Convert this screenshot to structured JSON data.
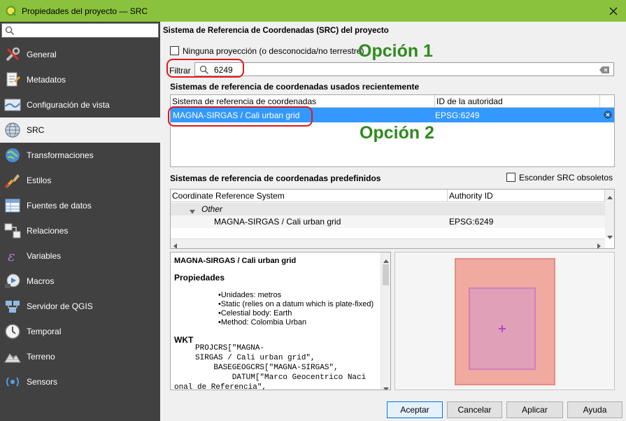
{
  "window": {
    "title": "Propiedades del proyecto — SRC"
  },
  "sidebar": {
    "items": [
      {
        "label": "General",
        "icon": "wrench-screwdriver-icon"
      },
      {
        "label": "Metadatos",
        "icon": "metadata-document-icon"
      },
      {
        "label": "Configuración de vista",
        "icon": "map-view-icon"
      },
      {
        "label": "SRC",
        "icon": "globe-icon",
        "selected": true
      },
      {
        "label": "Transformaciones",
        "icon": "globe-transform-icon"
      },
      {
        "label": "Estilos",
        "icon": "paint-brush-icon"
      },
      {
        "label": "Fuentes de datos",
        "icon": "table-icon"
      },
      {
        "label": "Relaciones",
        "icon": "relations-icon"
      },
      {
        "label": "Variables",
        "icon": "variable-icon"
      },
      {
        "label": "Macros",
        "icon": "macro-icon"
      },
      {
        "label": "Servidor de QGIS",
        "icon": "server-icon"
      },
      {
        "label": "Temporal",
        "icon": "clock-icon"
      },
      {
        "label": "Terreno",
        "icon": "terrain-icon"
      },
      {
        "label": "Sensors",
        "icon": "sensor-icon"
      }
    ]
  },
  "panel": {
    "title": "Sistema de Referencia de Coordenadas (SRC) del proyecto",
    "no_projection_label": "Ninguna proyección (o desconocida/no terrestre)",
    "filter_label": "Filtrar",
    "filter_value": "6249",
    "recent": {
      "title": "Sistemas de referencia de coordenadas usados recientemente",
      "headers": [
        "Sistema de referencia de coordenadas",
        "ID de la autoridad"
      ],
      "row": {
        "name": "MAGNA-SIRGAS / Cali urban grid",
        "id": "EPSG:6249"
      }
    },
    "predefined": {
      "title": "Sistemas de referencia de coordenadas predefinidos",
      "hide_label": "Esconder SRC obsoletos",
      "headers": [
        "Coordinate Reference System",
        "Authority ID"
      ],
      "group": "Other",
      "row": {
        "name": "MAGNA-SIRGAS / Cali urban grid",
        "id": "EPSG:6249"
      }
    },
    "details": {
      "name": "MAGNA-SIRGAS / Cali urban grid",
      "properties_heading": "Propiedades",
      "properties": [
        "Unidades: metros",
        "Static (relies on a datum which is plate-fixed)",
        "Celestial body: Earth",
        "Method: Colombia Urban"
      ],
      "wkt_heading": "WKT",
      "wkt_lines": [
        "PROJCRS[\"MAGNA-",
        "SIRGAS / Cali urban grid\",",
        "    BASEGEOGCRS[\"MAGNA-SIRGAS\",",
        "        DATUM[\"Marco Geocentrico Naci",
        "onal de Referencia\","
      ]
    }
  },
  "annotations": {
    "option1": "Opción 1",
    "option2": "Opción 2"
  },
  "buttons": {
    "ok": "Aceptar",
    "cancel": "Cancelar",
    "apply": "Aplicar",
    "help": "Ayuda"
  },
  "colors": {
    "titlebar": "#8ac23e",
    "sidebar": "#414141",
    "selection": "#3399ff",
    "annotation": "#2e8b1d",
    "highlight_ring": "#e31818"
  }
}
